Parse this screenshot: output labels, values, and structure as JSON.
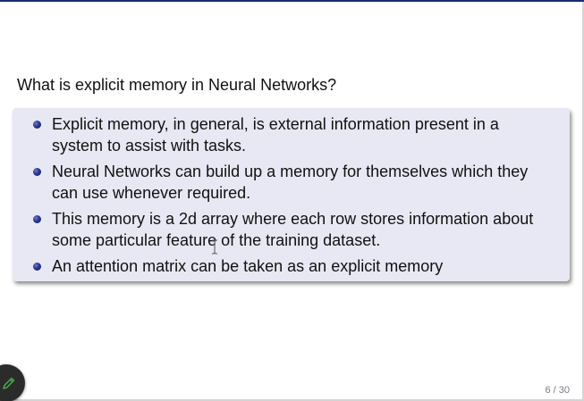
{
  "slide": {
    "title": "What is explicit memory in Neural Networks?",
    "bullets": [
      "Explicit memory, in general, is external information present in a system to assist with tasks.",
      "Neural Networks can build up a memory for themselves which they can use whenever required.",
      "This memory is a 2d array where each row stores information about some particular feature of the training dataset.",
      "An attention matrix can be taken as an explicit memory"
    ],
    "page_number": "6 / 30"
  },
  "controls": {
    "edit_icon": "pencil-icon"
  },
  "colors": {
    "block_background": "#e8e8f4",
    "bullet": "#2a3590",
    "top_bar": "#1c2a6e",
    "fab_background": "#2b2b2b",
    "fab_icon": "#4caf50"
  }
}
